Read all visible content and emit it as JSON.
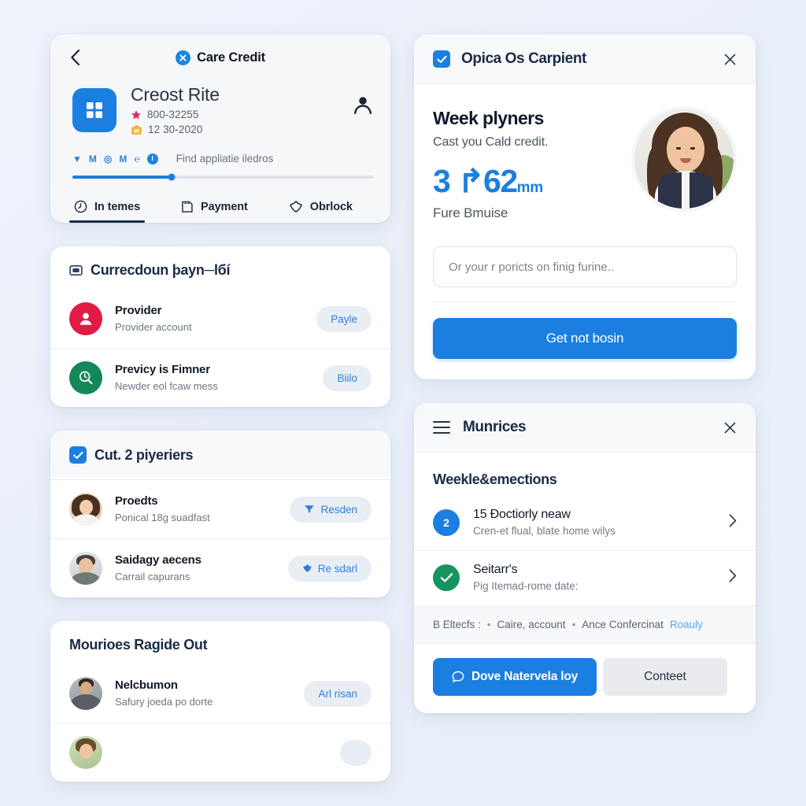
{
  "theme": {
    "page_bg": "#eef2fb",
    "accent_blue": "#1a7fe0",
    "dark_navy": "#1b2a45",
    "crimson": "#e01b45",
    "green": "#14875b",
    "pill_bg": "#e9eef4"
  },
  "top_left": {
    "brand_title": "Care Credit",
    "back_icon": "chevron-left-icon",
    "brand_badge_icon": "close-circle-icon",
    "business": {
      "logo_icon": "grid-four-pane-icon",
      "name": "Creost Rite",
      "meta": [
        {
          "icon": "star-icon",
          "text": "800-32255"
        },
        {
          "icon": "briefcase-icon",
          "text": "12 30-2020"
        }
      ],
      "profile_icon": "person-icon"
    },
    "mini_icons": [
      "filter-icon",
      "m-icon",
      "target-icon",
      "m-trend-icon",
      "em-icon",
      "info-circle-icon"
    ],
    "mini_hint": "Find appliatie iledros",
    "progress": {
      "percent": 33
    },
    "tabs": [
      {
        "icon": "clock-icon",
        "label": "In temes",
        "active": true
      },
      {
        "icon": "receipt-icon",
        "label": "Payment",
        "active": false
      },
      {
        "icon": "shield-icon",
        "label": "Obrlock",
        "active": false
      }
    ]
  },
  "mid_left": {
    "section_icon": "card-icon",
    "section_title": "Currecdoun þayn─lбí",
    "rows": [
      {
        "avatar_icon": "person-icon",
        "avatar_color": "crimson",
        "title": "Provider",
        "subtitle": "Provider account",
        "action": "Payle"
      },
      {
        "avatar_icon": "search-clock-icon",
        "avatar_color": "green",
        "title": "Previcy is Fimner",
        "subtitle": "Newder eol fcaw mess",
        "action": "Biilo"
      }
    ]
  },
  "bottom_left_a": {
    "checkbox_icon": "checkbox-checked-icon",
    "title": "Cut. 2 piyeriers",
    "rows": [
      {
        "title": "Proedts",
        "subtitle": "Ponical 18g suadfast",
        "action_icon": "filter-icon",
        "action": "Resden"
      },
      {
        "title": "Saidagy aecens",
        "subtitle": "Carrail capurans",
        "action_icon": "shield-icon",
        "action": "Re sdarl"
      }
    ]
  },
  "bottom_left_b": {
    "title": "Mourioes Ragide Out",
    "rows": [
      {
        "title": "Nelcbumon",
        "subtitle": "Safury joeda po dorte",
        "action": "Arl risan"
      }
    ]
  },
  "top_right": {
    "checkbox_icon": "checkbox-checked-icon",
    "title": "Opica Os Carpient",
    "close_icon": "close-icon",
    "hero_heading": "Week plyners",
    "hero_sub": "Cast you Cald credit.",
    "hero_number": "3 ↱62",
    "hero_unit": "mm",
    "hero_caption": "Fure Bmuise",
    "input_placeholder": "Or your r poricts on finig furine..",
    "input_value": "",
    "primary_button": "Get not bosin",
    "photo_alt": "smiling-woman-portrait"
  },
  "bottom_right": {
    "menu_icon": "hamburger-menu-icon",
    "title": "Munrices",
    "close_icon": "close-icon",
    "section_title": "Weekle&emections",
    "rows": [
      {
        "badge": "2",
        "badge_color": "blue",
        "badge_icon": "count-badge",
        "title": "15 Đoctiorly neaw",
        "subtitle": "Cren-et flual, blate home wilys",
        "chevron": "chevron-right-icon"
      },
      {
        "badge": "✓",
        "badge_color": "green",
        "badge_icon": "check-circle-icon",
        "title": "Seitarr's",
        "subtitle": "Pig Itemad-rome date:",
        "chevron": "chevron-right-icon"
      }
    ],
    "links_prefix": "B Eltecfs :",
    "links": [
      "Caire, account",
      "Ance Confercinat"
    ],
    "links_highlight": "Roauly",
    "actions": {
      "primary_icon": "chat-bubble-icon",
      "primary": "Dove Natervela loy",
      "secondary": "Conteet"
    }
  }
}
